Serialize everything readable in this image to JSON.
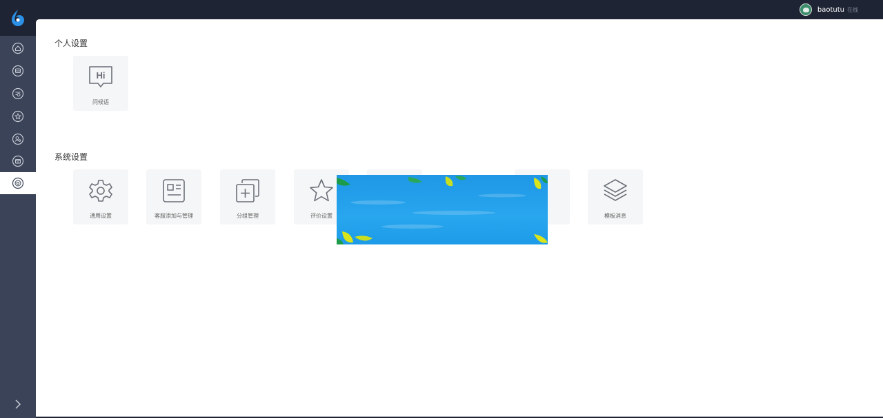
{
  "header": {
    "username": "baotutu",
    "status": "在线"
  },
  "sidebar": {
    "items": [
      {
        "icon": "home-icon"
      },
      {
        "icon": "bus-icon"
      },
      {
        "icon": "list-icon"
      },
      {
        "icon": "star-icon"
      },
      {
        "icon": "user-icon"
      },
      {
        "icon": "store-icon"
      },
      {
        "icon": "settings-icon",
        "active": true
      }
    ],
    "collapse_icon": "chevron-right-icon"
  },
  "personal": {
    "title": "个人设置",
    "cards": [
      {
        "label": "问候语",
        "icon": "hi-chat-icon"
      }
    ]
  },
  "system": {
    "title": "系统设置",
    "cards": [
      {
        "label": "通用设置",
        "icon": "gear-icon"
      },
      {
        "label": "客服添加与管理",
        "icon": "id-card-icon"
      },
      {
        "label": "分组管理",
        "icon": "add-group-icon"
      },
      {
        "label": "评价设置",
        "icon": "star-icon"
      },
      {
        "label": "",
        "icon": "hidden-card-icon"
      },
      {
        "label": "",
        "icon": "hidden-card-icon"
      },
      {
        "label": "模板消息",
        "icon": "layers-icon"
      }
    ]
  },
  "colors": {
    "sidebar_bg": "#3a4357",
    "topbar_bg": "#1f2434",
    "accent": "#2b90e6",
    "card_bg": "#f5f6f7"
  }
}
